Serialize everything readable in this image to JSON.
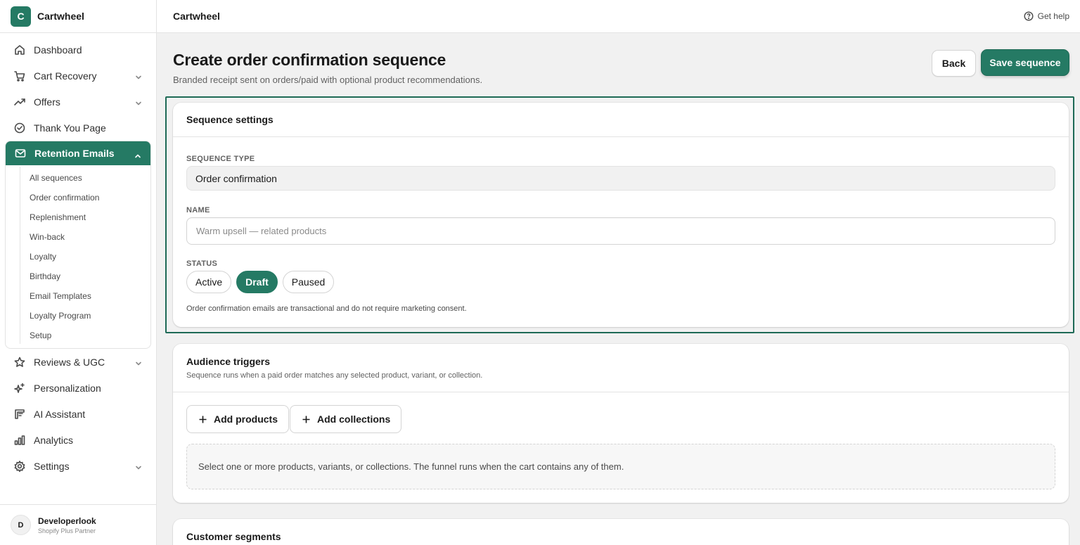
{
  "brand": {
    "logo_letter": "C",
    "name": "Cartwheel",
    "accent": "#257a64"
  },
  "topbar": {
    "title": "Cartwheel",
    "help": "Get help"
  },
  "nav": {
    "dashboard": "Dashboard",
    "cart_recovery": "Cart Recovery",
    "offers": "Offers",
    "thank_you": "Thank You Page",
    "retention": "Retention Emails",
    "sub": [
      "All sequences",
      "Order confirmation",
      "Replenishment",
      "Win-back",
      "Loyalty",
      "Birthday",
      "Email Templates",
      "Loyalty Program",
      "Setup"
    ],
    "reviews": "Reviews & UGC",
    "personalization": "Personalization",
    "ai": "AI Assistant",
    "analytics": "Analytics",
    "settings": "Settings"
  },
  "user": {
    "initial": "D",
    "name": "Developerlook",
    "role": "Shopify Plus Partner"
  },
  "page": {
    "title": "Create order confirmation sequence",
    "subtitle": "Branded receipt sent on orders/paid with optional product recommendations.",
    "back": "Back",
    "save": "Save sequence"
  },
  "settings_card": {
    "title": "Sequence settings",
    "type_label": "SEQUENCE TYPE",
    "type_value": "Order confirmation",
    "name_label": "NAME",
    "name_placeholder": "Warm upsell — related products",
    "status_label": "STATUS",
    "status_options": [
      "Active",
      "Draft",
      "Paused"
    ],
    "status_selected": "Draft",
    "hint": "Order confirmation emails are transactional and do not require marketing consent."
  },
  "audience_card": {
    "title": "Audience triggers",
    "desc": "Sequence runs when a paid order matches any selected product, variant, or collection.",
    "add_products": "Add products",
    "add_collections": "Add collections",
    "empty": "Select one or more products, variants, or collections. The funnel runs when the cart contains any of them."
  },
  "segments_card": {
    "title": "Customer segments"
  },
  "icons": [
    "home-icon",
    "cart-icon",
    "trend-icon",
    "check-circle-icon",
    "mail-icon",
    "star-icon",
    "sparkle-icon",
    "ai-icon",
    "bar-chart-icon",
    "gear-icon",
    "help-icon",
    "plus-icon",
    "chevron-down-icon",
    "chevron-up-icon"
  ]
}
